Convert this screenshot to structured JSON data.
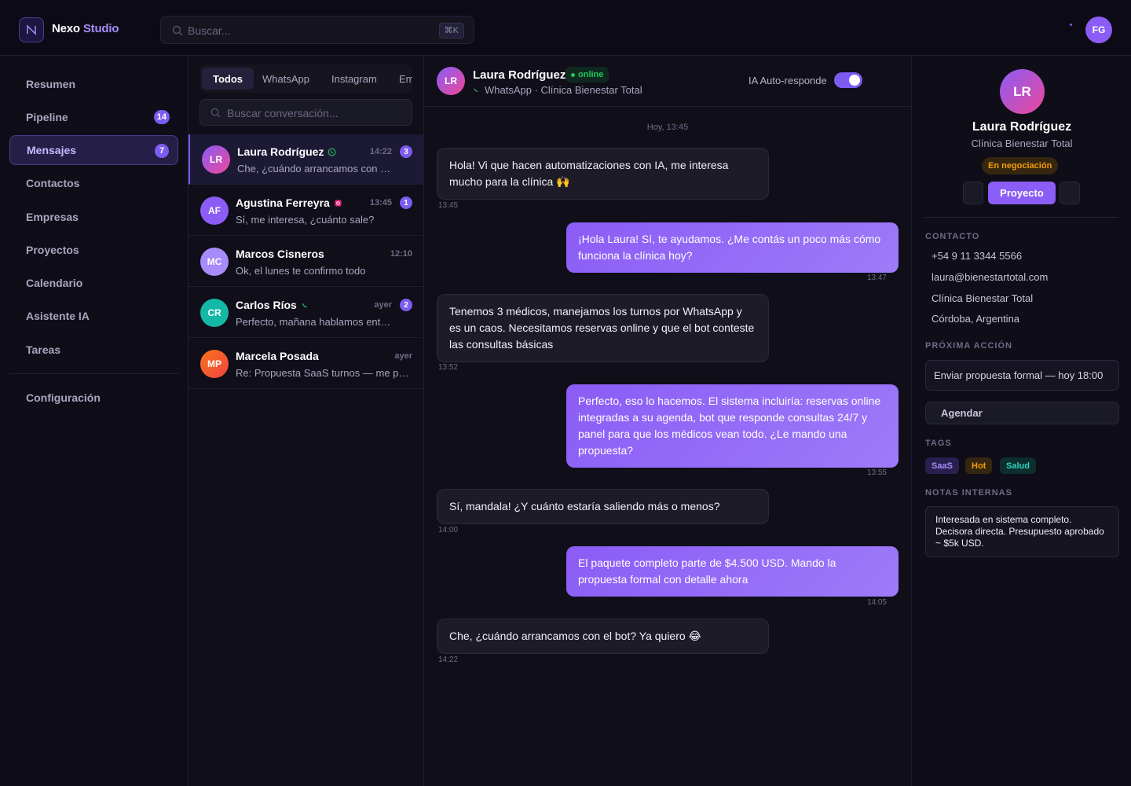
{
  "app": {
    "brand_name": "Nexo",
    "brand_accent": "Studio",
    "accent_color": "#8b5cf6"
  },
  "topbar": {
    "search_placeholder": "Buscar...",
    "shortcut": "⌘K",
    "user_initials": "FG"
  },
  "sidebar": {
    "items": [
      {
        "label": "Resumen",
        "badge": ""
      },
      {
        "label": "Pipeline",
        "badge": "14"
      },
      {
        "label": "Mensajes",
        "badge": "7",
        "active": true
      },
      {
        "label": "Contactos",
        "badge": ""
      },
      {
        "label": "Empresas",
        "badge": ""
      },
      {
        "label": "Proyectos",
        "badge": ""
      },
      {
        "label": "Calendario",
        "badge": ""
      },
      {
        "label": "Asistente IA",
        "badge": ""
      },
      {
        "label": "Tareas",
        "badge": ""
      }
    ],
    "settings_label": "Configuración"
  },
  "inbox": {
    "tabs": [
      "Todos",
      "WhatsApp",
      "Instagram",
      "Em"
    ],
    "search_placeholder": "Buscar conversación...",
    "conversations": [
      {
        "initials": "LR",
        "name": "Laura Rodríguez",
        "channel": "whatsapp",
        "time": "14:22",
        "preview": "Che, ¿cuándo arrancamos con el bot? Ya quiero",
        "unread": "3",
        "active": true
      },
      {
        "initials": "AF",
        "name": "Agustina Ferreyra",
        "channel": "instagram",
        "time": "13:45",
        "preview": "Sí, me interesa, ¿cuánto sale?",
        "unread": "1"
      },
      {
        "initials": "MC",
        "name": "Marcos Cisneros",
        "channel": "",
        "time": "12:10",
        "preview": "Ok, el lunes te confirmo todo",
        "unread": ""
      },
      {
        "initials": "CR",
        "name": "Carlos Ríos",
        "channel": "phone",
        "time": "ayer",
        "preview": "Perfecto, mañana hablamos entonces",
        "unread": "2"
      },
      {
        "initials": "MP",
        "name": "Marcela Posada",
        "channel": "",
        "time": "ayer",
        "preview": "Re: Propuesta SaaS turnos — me parece bien",
        "unread": ""
      }
    ]
  },
  "chat": {
    "contact_initials": "LR",
    "contact_name": "Laura Rodríguez",
    "status": "online",
    "subtitle": "WhatsApp · Clínica Bienestar Total",
    "auto_reply_label": "IA Auto-responde",
    "auto_reply_on": true,
    "day_label": "Hoy, 13:45",
    "messages": [
      {
        "dir": "in",
        "text": "Hola! Vi que hacen automatizaciones con IA, me interesa mucho para la clínica 🙌",
        "time": "13:45"
      },
      {
        "dir": "out",
        "text": "¡Hola Laura! Sí, te ayudamos. ¿Me contás un poco más cómo funciona la clínica hoy?",
        "time": "13:47"
      },
      {
        "dir": "in",
        "text": "Tenemos 3 médicos, manejamos los turnos por WhatsApp y es un caos. Necesitamos reservas online y que el bot conteste las consultas básicas",
        "time": "13:52"
      },
      {
        "dir": "out",
        "text": "Perfecto, eso lo hacemos. El sistema incluiría: reservas online integradas a su agenda, bot que responde consultas 24/7 y panel para que los médicos vean todo. ¿Le mando una propuesta?",
        "time": "13:55"
      },
      {
        "dir": "in",
        "text": "Sí, mandala! ¿Y cuánto estaría saliendo más o menos?",
        "time": "14:00"
      },
      {
        "dir": "out",
        "text": "El paquete completo parte de $4.500 USD. Mando la propuesta formal con detalle ahora",
        "time": "14:05"
      },
      {
        "dir": "in",
        "text": "Che, ¿cuándo arrancamos con el bot? Ya quiero 😂",
        "time": "14:22"
      }
    ]
  },
  "profile": {
    "initials": "LR",
    "name": "Laura Rodríguez",
    "company": "Clínica Bienestar Total",
    "stage": "En negociación",
    "project_button": "Proyecto",
    "contact_title": "CONTACTO",
    "phone": "+54 9 11 3344 5566",
    "email": "laura@bienestartotal.com",
    "company_line": "Clínica Bienestar Total",
    "location": "Córdoba, Argentina",
    "next_action_title": "PRÓXIMA ACCIÓN",
    "next_action": "Enviar propuesta formal — hoy 18:00",
    "schedule_button": "Agendar",
    "tags_title": "TAGS",
    "tags": [
      {
        "label": "SaaS",
        "color": "#a78bfa"
      },
      {
        "label": "Hot",
        "color": "#f59e0b"
      },
      {
        "label": "Salud",
        "color": "#2dd4bf"
      }
    ],
    "notes_title": "NOTAS INTERNAS",
    "notes": "Interesada en sistema completo. Decisora directa. Presupuesto aprobado ~ $5k USD."
  }
}
